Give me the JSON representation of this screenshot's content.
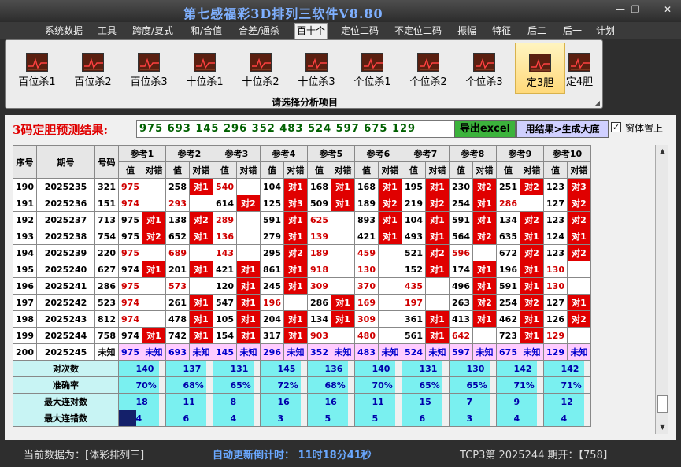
{
  "window": {
    "title": "第七感福彩3D排列三软件V8.80",
    "min": "—",
    "restore": "❐",
    "close": "✕"
  },
  "menu": [
    "系统数据",
    "工具",
    "跨度/复式",
    "和/合值",
    "合差/通杀",
    "百十个",
    "定位二码",
    "不定位二码",
    "振幅",
    "特征",
    "后二",
    "后一",
    "计划"
  ],
  "active_menu": 5,
  "ribbon": {
    "buttons": [
      "百位杀1",
      "百位杀2",
      "百位杀3",
      "十位杀1",
      "十位杀2",
      "十位杀3",
      "个位杀1",
      "个位杀2",
      "个位杀3",
      "定3胆",
      "定4胆"
    ],
    "active": 9,
    "caption": "请选择分析项目"
  },
  "predict": {
    "label": "3码定胆预测结果:",
    "result": "975 693 145 296 352 483 524 597 675 129",
    "export_btn": "导出excel",
    "gen_btn": "用结果>生成大底",
    "on_top_label": "窗体置上",
    "on_top_checked": true
  },
  "table": {
    "col_headers": [
      "序号",
      "期号",
      "号码"
    ],
    "ref_groups": [
      "参考1",
      "参考2",
      "参考3",
      "参考4",
      "参考5",
      "参考6",
      "参考7",
      "参考8",
      "参考9",
      "参考10"
    ],
    "sub_value": "值",
    "sub_check": "对错",
    "rows": [
      {
        "seq": "190",
        "issue": "2025235",
        "num": "321",
        "cells": [
          [
            "975",
            ""
          ],
          [
            "258",
            "对1"
          ],
          [
            "540",
            ""
          ],
          [
            "104",
            "对1"
          ],
          [
            "168",
            "对1"
          ],
          [
            "168",
            "对1"
          ],
          [
            "195",
            "对1"
          ],
          [
            "230",
            "对2"
          ],
          [
            "251",
            "对2"
          ],
          [
            "123",
            "对3"
          ]
        ]
      },
      {
        "seq": "191",
        "issue": "2025236",
        "num": "151",
        "cells": [
          [
            "974",
            ""
          ],
          [
            "293",
            ""
          ],
          [
            "614",
            "对2"
          ],
          [
            "125",
            "对3"
          ],
          [
            "509",
            "对1"
          ],
          [
            "189",
            "对2"
          ],
          [
            "219",
            "对2"
          ],
          [
            "254",
            "对1"
          ],
          [
            "286",
            ""
          ],
          [
            "127",
            "对2"
          ]
        ]
      },
      {
        "seq": "192",
        "issue": "2025237",
        "num": "713",
        "cells": [
          [
            "975",
            "对1"
          ],
          [
            "138",
            "对2"
          ],
          [
            "289",
            ""
          ],
          [
            "591",
            "对1"
          ],
          [
            "625",
            ""
          ],
          [
            "893",
            "对1"
          ],
          [
            "104",
            "对1"
          ],
          [
            "591",
            "对1"
          ],
          [
            "134",
            "对2"
          ],
          [
            "123",
            "对2"
          ]
        ]
      },
      {
        "seq": "193",
        "issue": "2025238",
        "num": "754",
        "cells": [
          [
            "975",
            "对2"
          ],
          [
            "652",
            "对1"
          ],
          [
            "136",
            ""
          ],
          [
            "279",
            "对1"
          ],
          [
            "139",
            ""
          ],
          [
            "421",
            "对1"
          ],
          [
            "493",
            "对1"
          ],
          [
            "564",
            "对2"
          ],
          [
            "635",
            "对1"
          ],
          [
            "124",
            "对1"
          ]
        ]
      },
      {
        "seq": "194",
        "issue": "2025239",
        "num": "220",
        "cells": [
          [
            "975",
            ""
          ],
          [
            "689",
            ""
          ],
          [
            "143",
            ""
          ],
          [
            "295",
            "对2"
          ],
          [
            "189",
            ""
          ],
          [
            "459",
            ""
          ],
          [
            "521",
            "对2"
          ],
          [
            "596",
            ""
          ],
          [
            "672",
            "对2"
          ],
          [
            "123",
            "对2"
          ]
        ]
      },
      {
        "seq": "195",
        "issue": "2025240",
        "num": "627",
        "cells": [
          [
            "974",
            "对1"
          ],
          [
            "201",
            "对1"
          ],
          [
            "421",
            "对1"
          ],
          [
            "861",
            "对1"
          ],
          [
            "918",
            ""
          ],
          [
            "130",
            ""
          ],
          [
            "152",
            "对1"
          ],
          [
            "174",
            "对1"
          ],
          [
            "196",
            "对1"
          ],
          [
            "130",
            ""
          ]
        ]
      },
      {
        "seq": "196",
        "issue": "2025241",
        "num": "286",
        "cells": [
          [
            "975",
            ""
          ],
          [
            "573",
            ""
          ],
          [
            "120",
            "对1"
          ],
          [
            "245",
            "对1"
          ],
          [
            "309",
            ""
          ],
          [
            "370",
            ""
          ],
          [
            "435",
            ""
          ],
          [
            "496",
            "对1"
          ],
          [
            "591",
            "对1"
          ],
          [
            "130",
            ""
          ]
        ]
      },
      {
        "seq": "197",
        "issue": "2025242",
        "num": "523",
        "cells": [
          [
            "974",
            ""
          ],
          [
            "261",
            "对1"
          ],
          [
            "547",
            "对1"
          ],
          [
            "196",
            ""
          ],
          [
            "286",
            "对1"
          ],
          [
            "169",
            ""
          ],
          [
            "197",
            ""
          ],
          [
            "263",
            "对2"
          ],
          [
            "254",
            "对2"
          ],
          [
            "127",
            "对1"
          ]
        ]
      },
      {
        "seq": "198",
        "issue": "2025243",
        "num": "812",
        "cells": [
          [
            "974",
            ""
          ],
          [
            "478",
            "对1"
          ],
          [
            "105",
            "对1"
          ],
          [
            "204",
            "对1"
          ],
          [
            "134",
            "对1"
          ],
          [
            "309",
            ""
          ],
          [
            "361",
            "对1"
          ],
          [
            "413",
            "对1"
          ],
          [
            "462",
            "对1"
          ],
          [
            "126",
            "对2"
          ]
        ]
      },
      {
        "seq": "199",
        "issue": "2025244",
        "num": "758",
        "cells": [
          [
            "974",
            "对1"
          ],
          [
            "742",
            "对1"
          ],
          [
            "154",
            "对1"
          ],
          [
            "317",
            "对1"
          ],
          [
            "903",
            ""
          ],
          [
            "480",
            ""
          ],
          [
            "561",
            "对1"
          ],
          [
            "642",
            ""
          ],
          [
            "723",
            "对1"
          ],
          [
            "129",
            ""
          ]
        ]
      }
    ],
    "pending": {
      "seq": "200",
      "issue": "2025245",
      "num": "未知",
      "values": [
        "975",
        "693",
        "145",
        "296",
        "352",
        "483",
        "524",
        "597",
        "675",
        "129"
      ],
      "status": "未知"
    },
    "stats": [
      {
        "label": "对次数",
        "values": [
          "140",
          "137",
          "131",
          "145",
          "136",
          "140",
          "131",
          "130",
          "142",
          "142"
        ]
      },
      {
        "label": "准确率",
        "values": [
          "70%",
          "68%",
          "65%",
          "72%",
          "68%",
          "70%",
          "65%",
          "65%",
          "71%",
          "71%"
        ]
      },
      {
        "label": "最大连对数",
        "values": [
          "18",
          "11",
          "8",
          "16",
          "16",
          "11",
          "15",
          "7",
          "9",
          "12"
        ]
      },
      {
        "label": "最大连错数",
        "values": [
          "4",
          "6",
          "4",
          "3",
          "5",
          "5",
          "6",
          "3",
          "4",
          "4"
        ]
      }
    ]
  },
  "status": {
    "current": "当前数据为：[体彩排列三]",
    "countdown": "自动更新倒计时： 11时18分41秒",
    "latest": "TCP3第 2025244 期开：【758】"
  },
  "colors": {
    "hit": "#e00000",
    "value_red": "#d00000",
    "stat_value": "#0000aa"
  }
}
